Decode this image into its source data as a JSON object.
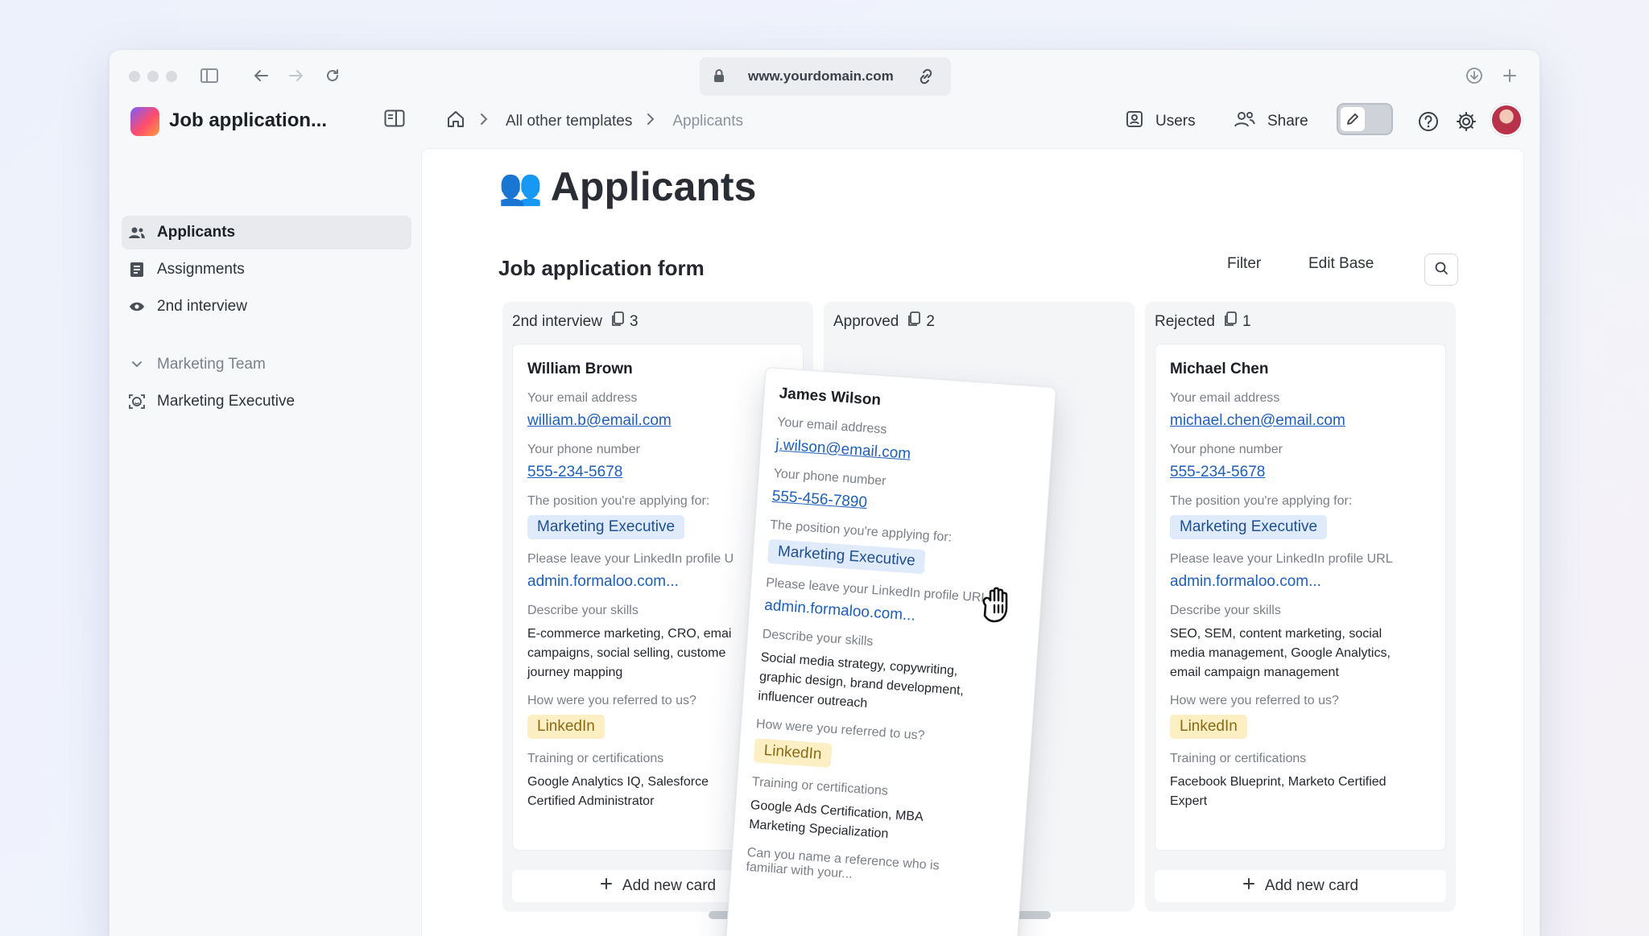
{
  "browser": {
    "url": "www.yourdomain.com"
  },
  "app": {
    "title": "Job application...",
    "breadcrumbs": [
      "All other templates",
      "Applicants"
    ],
    "header_buttons": {
      "users": "Users",
      "share": "Share"
    }
  },
  "sidebar": {
    "items": [
      {
        "label": "Applicants",
        "icon": "users-icon",
        "active": true
      },
      {
        "label": "Assignments",
        "icon": "form-icon"
      },
      {
        "label": "2nd interview",
        "icon": "eye-icon"
      }
    ],
    "group": {
      "label": "Marketing Team",
      "icon": "chevron-down-icon"
    },
    "group_items": [
      {
        "label": "Marketing Executive",
        "icon": "face-scan-icon"
      }
    ]
  },
  "page": {
    "title": "Applicants",
    "emoji": "👥",
    "section_title": "Job application form",
    "filter_label": "Filter",
    "edit_base_label": "Edit Base"
  },
  "columns": [
    {
      "title": "2nd interview",
      "count": "3",
      "add_label": "Add new card"
    },
    {
      "title": "Approved",
      "count": "2"
    },
    {
      "title": "Rejected",
      "count": "1",
      "add_label": "Add new card"
    }
  ],
  "field_labels": {
    "email": "Your email address",
    "phone": "Your phone number",
    "position": "The position you're applying for:",
    "linkedin": "Please leave your LinkedIn profile URL",
    "linkedin_cut": "Please leave your LinkedIn profile U",
    "skills": "Describe your skills",
    "referral": "How were you referred to us?",
    "training": "Training or certifications",
    "reference": "Can you name a reference who is"
  },
  "cards": {
    "william": {
      "name": "William Brown",
      "email": "william.b@email.com",
      "phone": "555-234-5678",
      "position": "Marketing Executive",
      "linkedin": "admin.formaloo.com...",
      "skills_lines": [
        "E-commerce marketing, CRO, emai",
        "campaigns, social selling, custome",
        "journey mapping"
      ],
      "referral": "LinkedIn",
      "training_lines": [
        "Google Analytics IQ, Salesforce",
        "Certified Administrator"
      ]
    },
    "james": {
      "name": "James Wilson",
      "email": "j.wilson@email.com",
      "phone": "555-456-7890",
      "position": "Marketing Executive",
      "linkedin": "admin.formaloo.com...",
      "skills_lines": [
        "Social media strategy, copywriting,",
        "graphic design, brand development,",
        "influencer outreach"
      ],
      "referral": "LinkedIn",
      "training_lines": [
        "Google Ads Certification, MBA",
        "Marketing Specialization"
      ],
      "reference_lines": [
        "Can you name a reference who is",
        "familiar with your..."
      ]
    },
    "michael": {
      "name": "Michael Chen",
      "email": "michael.chen@email.com",
      "phone": "555-234-5678",
      "position": "Marketing Executive",
      "linkedin": "admin.formaloo.com...",
      "skills_lines": [
        "SEO, SEM, content marketing, social",
        "media management, Google Analytics,",
        "email campaign management"
      ],
      "referral": "LinkedIn",
      "training_lines": [
        "Facebook Blueprint, Marketo Certified",
        "Expert"
      ]
    }
  },
  "colors": {
    "link": "#1f5fb8",
    "tag_blue_bg": "#dfeafb",
    "tag_yellow_bg": "#fcefc4"
  }
}
